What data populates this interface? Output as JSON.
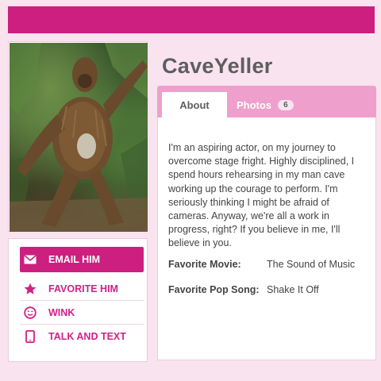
{
  "profile": {
    "username": "CaveYeller"
  },
  "actions": {
    "email_label": "EMAIL HIM",
    "favorite_label": "FAVORITE HIM",
    "wink_label": "WINK",
    "talk_label": "TALK AND TEXT"
  },
  "tabs": {
    "about_label": "About",
    "photos_label": "Photos",
    "photos_count": "6"
  },
  "about": {
    "bio": "I'm an aspiring actor, on my journey to overcome stage fright. Highly disciplined, I spend hours rehearsing in my man cave working up the courage to perform. I'm seriously thinking I might be afraid of cameras. Anyway, we're all a work in progress, right? If you believe in me, I'll believe in you.",
    "favorites": [
      {
        "label": "Favorite Movie:",
        "value": "The Sound of Music"
      },
      {
        "label": "Favorite Pop Song:",
        "value": "Shake It Off"
      }
    ]
  },
  "colors": {
    "brand": "#cc1f80",
    "tab_bar": "#ef9fcc",
    "background": "#f8e3ef",
    "text": "#444444"
  },
  "icons": {
    "email": "envelope-icon",
    "favorite": "star-icon",
    "wink": "wink-face-icon",
    "talk": "phone-icon",
    "photo_like": "thumbs-up-icon"
  }
}
